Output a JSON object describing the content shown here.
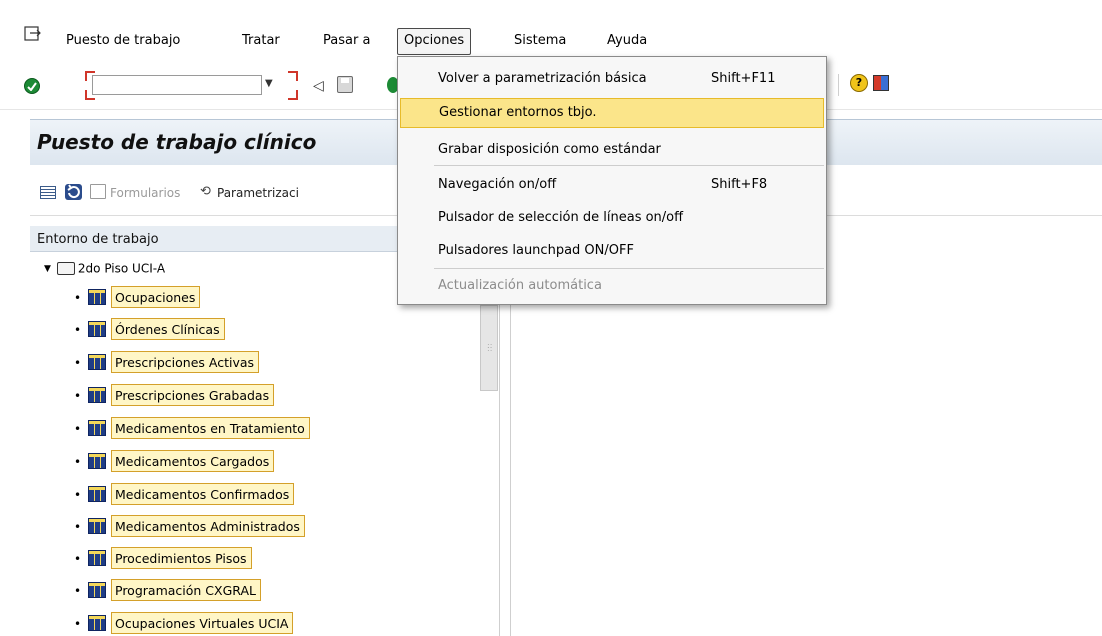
{
  "menubar": {
    "items": [
      {
        "label": "Puesto de trabajo"
      },
      {
        "label": "Tratar"
      },
      {
        "label": "Pasar a"
      },
      {
        "label": "Opciones"
      },
      {
        "label": "Sistema"
      },
      {
        "label": "Ayuda"
      }
    ],
    "active_item": "Opciones"
  },
  "toolbar": {
    "command_field_value": "",
    "icons": [
      "check-icon",
      "dropdown-icon",
      "back-icon",
      "save-icon",
      "green-icon",
      "help-icon",
      "layout-icon"
    ]
  },
  "title": "Puesto de trabajo clínico",
  "app_toolbar": {
    "formularios_label": "Formularios",
    "parametrizacion_label": "Parametrizaci"
  },
  "tree": {
    "header": "Entorno de trabajo",
    "root": "2do Piso UCI-A",
    "nodes": [
      "Ocupaciones",
      "Órdenes Clínicas",
      "Prescripciones Activas",
      "Prescripciones Grabadas",
      "Medicamentos en Tratamiento",
      "Medicamentos  Cargados",
      "Medicamentos Confirmados",
      "Medicamentos Administrados",
      "Procedimientos Pisos",
      "Programación CXGRAL",
      "Ocupaciones Virtuales UCIA"
    ]
  },
  "dropdown": {
    "items": [
      {
        "label": "Volver a parametrización básica",
        "shortcut": "Shift+F11",
        "state": "normal"
      },
      {
        "label": "Gestionar entornos tbjo.",
        "shortcut": "",
        "state": "highlighted"
      },
      {
        "label": "Grabar disposición como estándar",
        "shortcut": "",
        "state": "normal"
      },
      {
        "label": "Navegación on/off",
        "shortcut": "Shift+F8",
        "state": "normal"
      },
      {
        "label": "Pulsador de selección de líneas on/off",
        "shortcut": "",
        "state": "normal"
      },
      {
        "label": "Pulsadores launchpad ON/OFF",
        "shortcut": "",
        "state": "normal"
      },
      {
        "label": "Actualización automática",
        "shortcut": "",
        "state": "disabled"
      }
    ]
  },
  "colors": {
    "highlight": "#fbe58a",
    "node_fill": "#fff6c6",
    "node_border": "#d4a02a",
    "title_bar": "#dde6ef"
  }
}
